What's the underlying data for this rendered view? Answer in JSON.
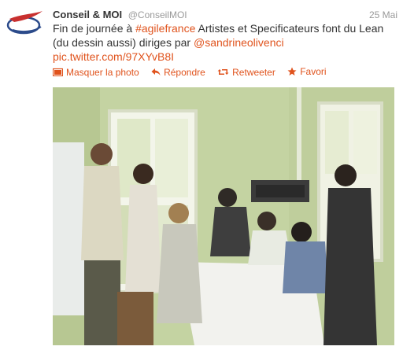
{
  "tweet": {
    "author_name": "Conseil & MOI",
    "author_handle": "@ConseilMOI",
    "timestamp": "25 Mai",
    "text_segments": {
      "part1": "Fin de journée à ",
      "hashtag": "#agilefrance",
      "part2": " Artistes et Specificateurs font du Lean (du dessin aussi) diriges par ",
      "mention": "@sandrineolivenci",
      "media_link": "pic.twitter.com/97XYvB8I"
    }
  },
  "actions": {
    "hide_photo": "Masquer la photo",
    "reply": "Répondre",
    "retweet": "Retweeter",
    "favorite": "Favori"
  },
  "colors": {
    "link": "#e0531d",
    "muted": "#999999",
    "text": "#333333"
  },
  "icons": [
    "logo-icon",
    "photo-icon",
    "reply-icon",
    "retweet-icon",
    "star-icon"
  ]
}
